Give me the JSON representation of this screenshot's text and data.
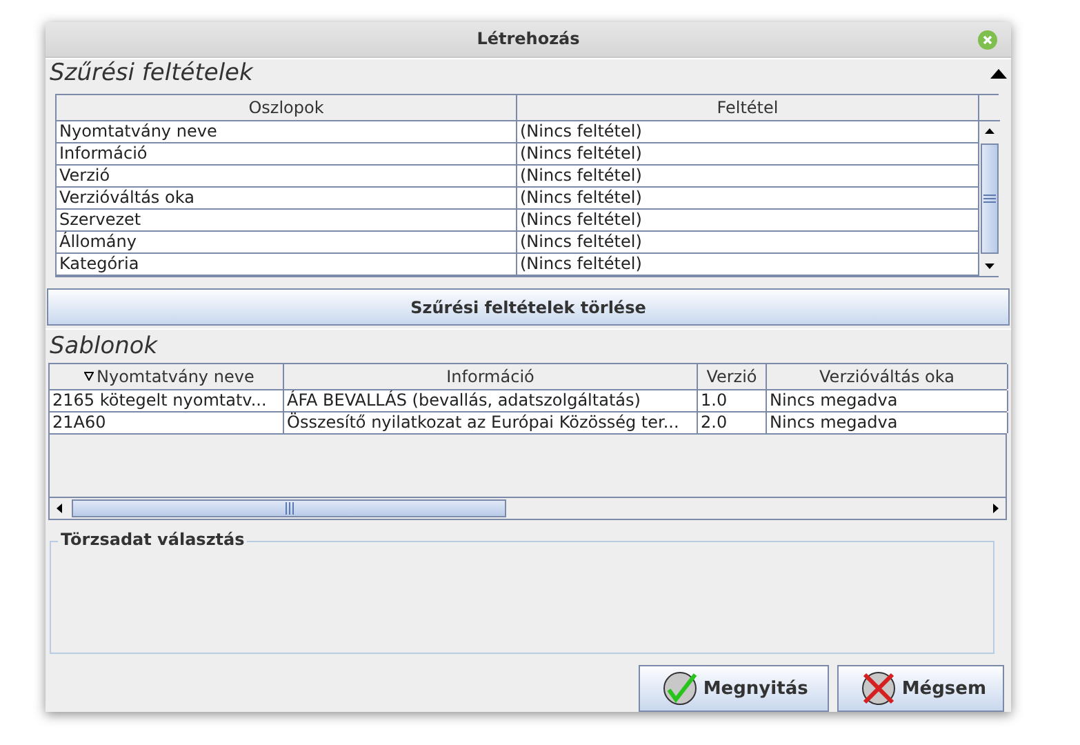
{
  "window": {
    "title": "Létrehozás"
  },
  "filter_section": {
    "title": "Szűrési feltételek",
    "columns": [
      "Oszlopok",
      "Feltétel"
    ],
    "rows": [
      {
        "column": "Nyomtatvány neve",
        "condition": "(Nincs feltétel)"
      },
      {
        "column": "Információ",
        "condition": "(Nincs feltétel)"
      },
      {
        "column": "Verzió",
        "condition": "(Nincs feltétel)"
      },
      {
        "column": "Verzióváltás oka",
        "condition": "(Nincs feltétel)"
      },
      {
        "column": "Szervezet",
        "condition": "(Nincs feltétel)"
      },
      {
        "column": "Állomány",
        "condition": "(Nincs feltétel)"
      },
      {
        "column": "Kategória",
        "condition": "(Nincs feltétel)"
      }
    ]
  },
  "clear_button": "Szűrési feltételek törlése",
  "templates": {
    "title": "Sablonok",
    "columns": [
      {
        "label": "Nyomtatvány neve",
        "sorted": true
      },
      {
        "label": "Információ",
        "sorted": false
      },
      {
        "label": "Verzió",
        "sorted": false
      },
      {
        "label": "Verzióváltás oka",
        "sorted": false
      }
    ],
    "rows": [
      [
        "2165 kötegelt nyomtatv...",
        "ÁFA BEVALLÁS (bevallás, adatszolgáltatás)",
        "1.0",
        "Nincs megadva"
      ],
      [
        "21A60",
        "Összesítő nyilatkozat az Európai Közösség ter...",
        "2.0",
        "Nincs megadva"
      ]
    ]
  },
  "master_data": {
    "title": "Törzsadat választás"
  },
  "buttons": [
    {
      "label": "Megnyitás",
      "kind": "ok"
    },
    {
      "label": "Mégsem",
      "kind": "cancel"
    }
  ]
}
